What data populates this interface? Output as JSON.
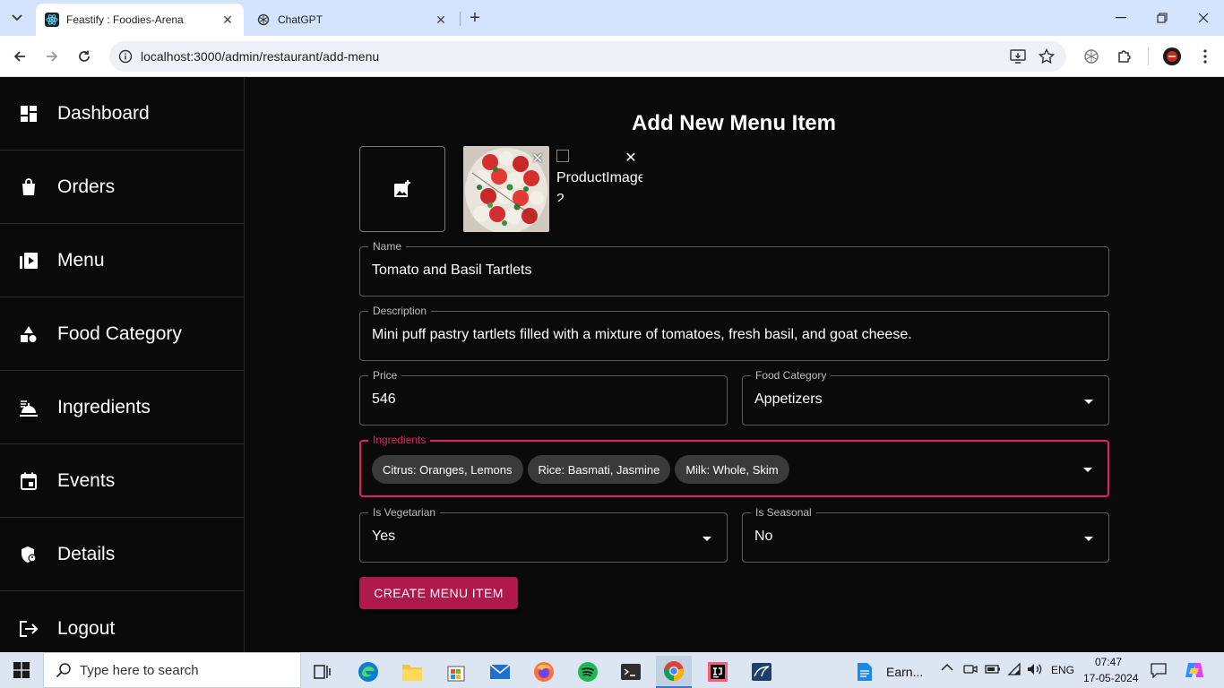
{
  "browser": {
    "tabs": [
      {
        "title": "Feastify : Foodies-Arena",
        "active": true
      },
      {
        "title": "ChatGPT",
        "active": false
      }
    ],
    "url": "localhost:3000/admin/restaurant/add-menu"
  },
  "sidebar": {
    "items": [
      {
        "label": "Dashboard",
        "icon": "dashboard-icon"
      },
      {
        "label": "Orders",
        "icon": "shopping-bag-icon"
      },
      {
        "label": "Menu",
        "icon": "video-library-icon"
      },
      {
        "label": "Food Category",
        "icon": "category-icon"
      },
      {
        "label": "Ingredients",
        "icon": "room-service-icon"
      },
      {
        "label": "Events",
        "icon": "event-icon"
      },
      {
        "label": "Details",
        "icon": "admin-panel-icon"
      },
      {
        "label": "Logout",
        "icon": "logout-icon"
      }
    ]
  },
  "form": {
    "title": "Add New Menu Item",
    "broken_image_alt": "ProductImage 2",
    "name": {
      "label": "Name",
      "value": "Tomato and Basil Tartlets"
    },
    "description": {
      "label": "Description",
      "value": "Mini puff pastry tartlets filled with a mixture of tomatoes, fresh basil, and goat cheese."
    },
    "price": {
      "label": "Price",
      "value": "546"
    },
    "food_category": {
      "label": "Food Category",
      "value": "Appetizers"
    },
    "ingredients": {
      "label": "Ingredients",
      "chips": [
        "Citrus: Oranges, Lemons",
        "Rice: Basmati, Jasmine",
        "Milk: Whole, Skim"
      ]
    },
    "is_vegetarian": {
      "label": "Is Vegetarian",
      "value": "Yes"
    },
    "is_seasonal": {
      "label": "Is Seasonal",
      "value": "No"
    },
    "submit_label": "CREATE MENU ITEM"
  },
  "taskbar": {
    "search_placeholder": "Type here to search",
    "pinned_window_label": "Earn...",
    "language": "ENG",
    "time": "07:47",
    "date": "17-05-2024"
  },
  "colors": {
    "accent": "#e91e63",
    "button": "#b0184b",
    "background": "#0a0a0a",
    "chip": "#3a3a3a"
  }
}
